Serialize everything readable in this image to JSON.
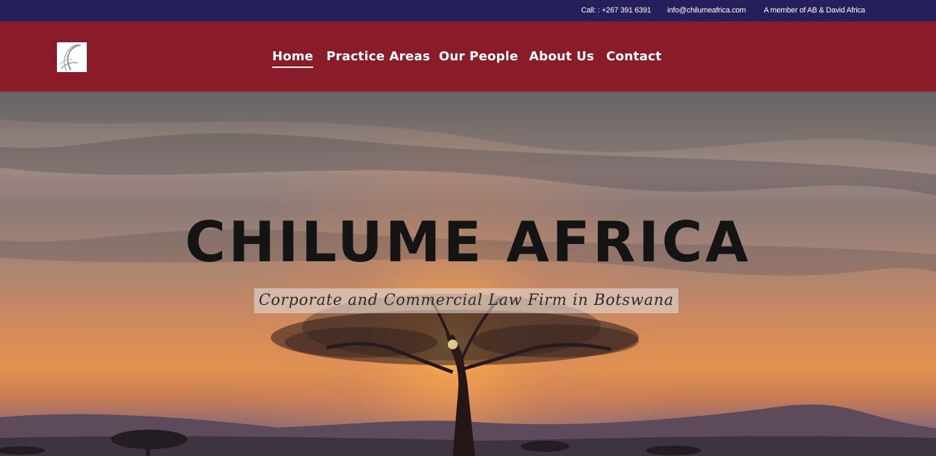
{
  "topbar": {
    "call": "Call: : +267 391 6391",
    "email": "info@chilumeafrica.com",
    "member": "A member of AB & David Africa"
  },
  "nav": {
    "items": [
      {
        "label": "Home"
      },
      {
        "label": "Practice Areas"
      },
      {
        "label": "Our People"
      },
      {
        "label": "About Us"
      },
      {
        "label": "Contact"
      }
    ],
    "active": "Home"
  },
  "hero": {
    "title": "CHILUME AFRICA",
    "subtitle": "Corporate and Commercial Law Firm in Botswana"
  },
  "colors": {
    "topbar_bg": "#25205c",
    "header_bg": "#8a1c2a"
  },
  "icons": {
    "logo": "crescent-logo-icon"
  }
}
